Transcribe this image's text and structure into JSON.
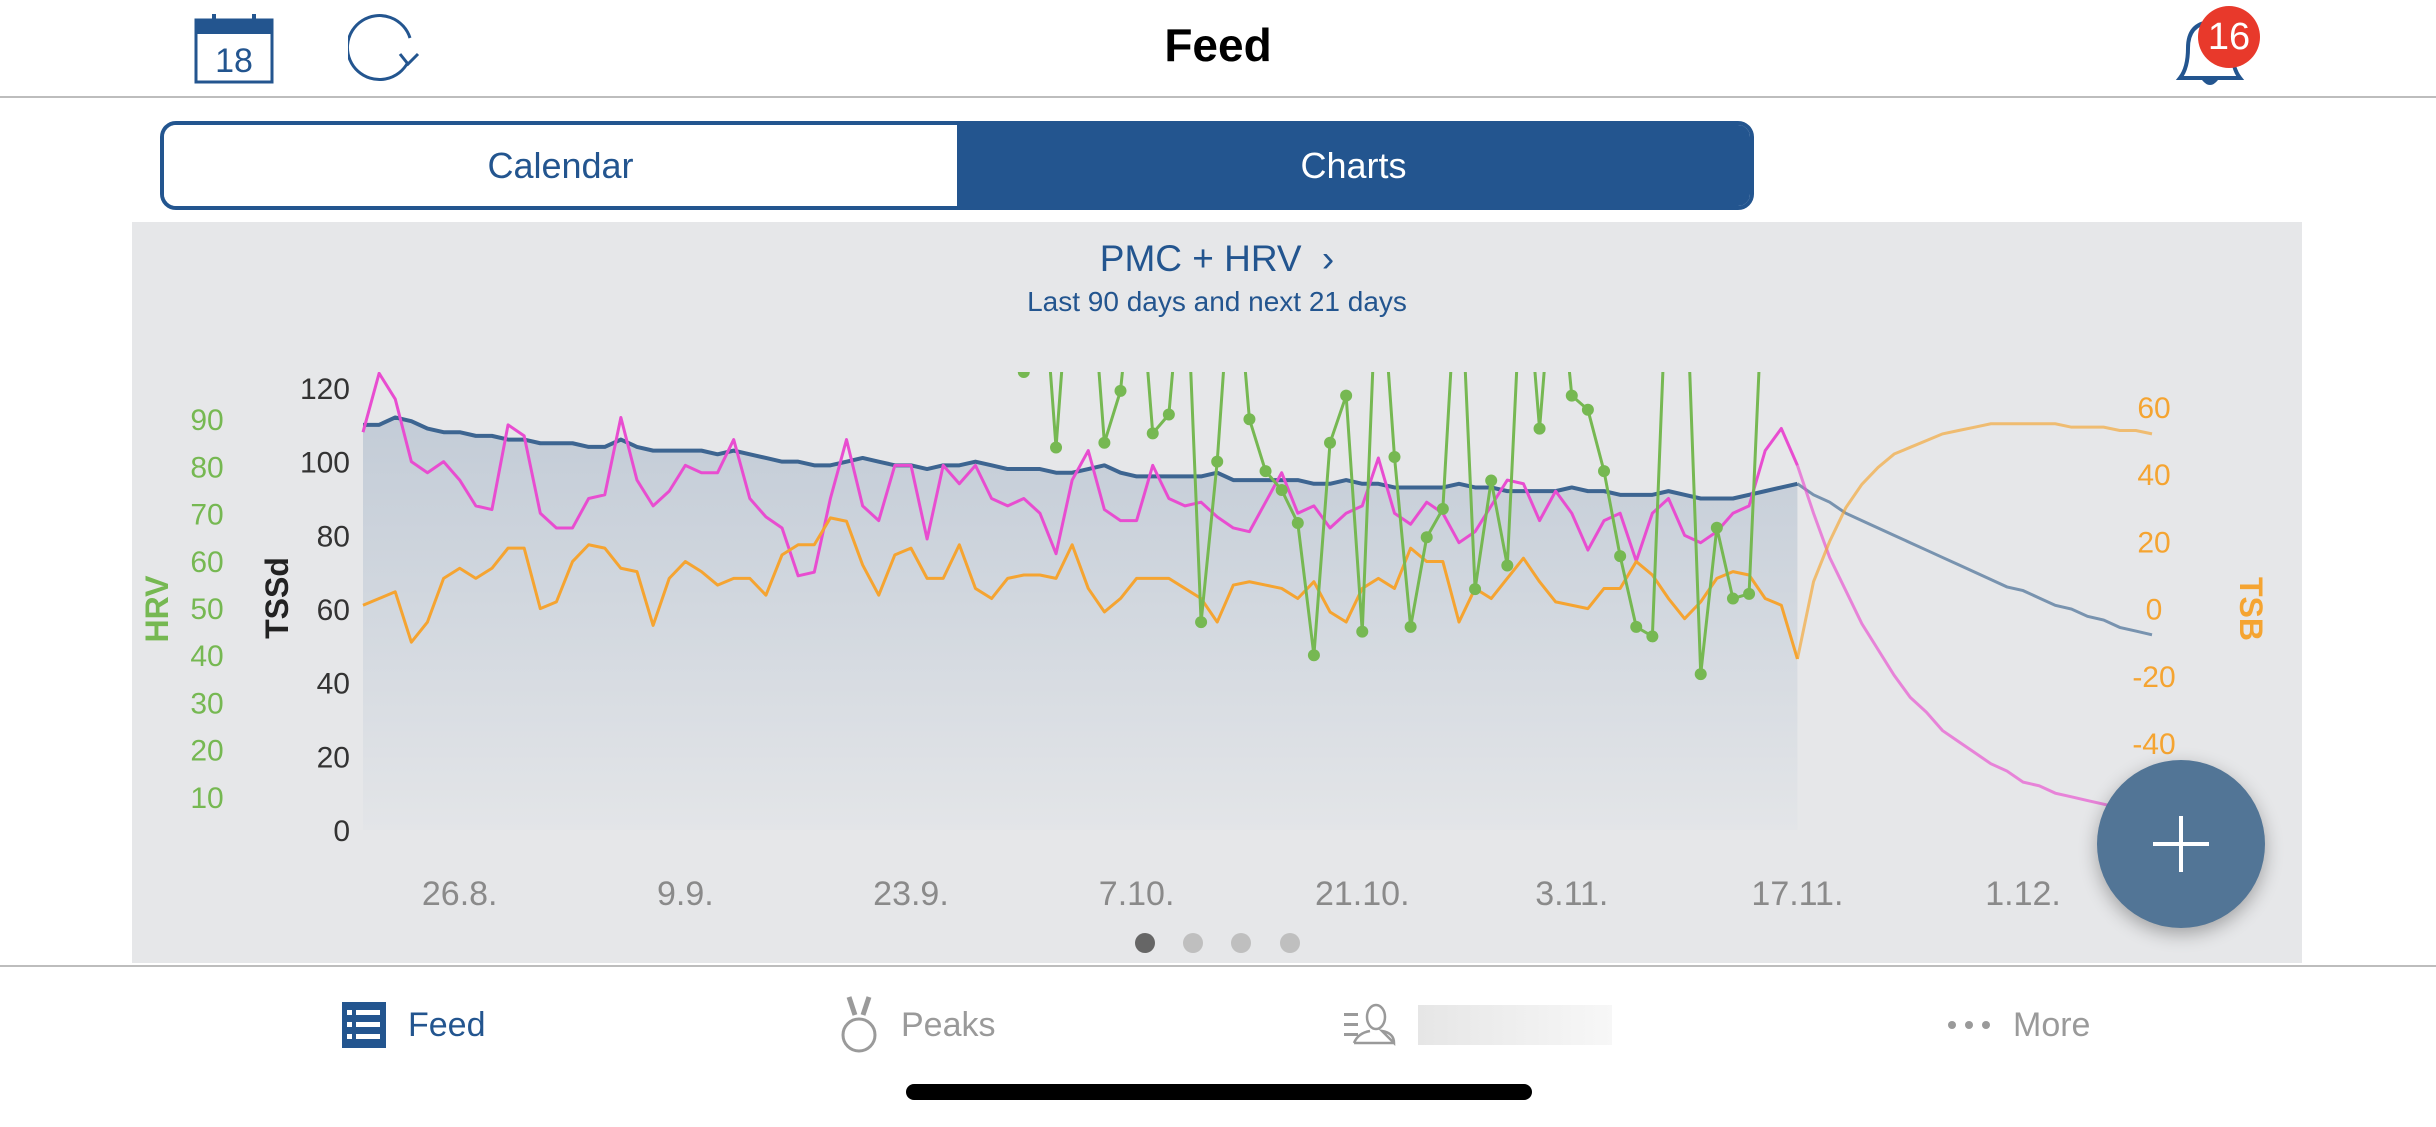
{
  "header": {
    "title": "Feed",
    "calendar_day": "18",
    "notification_count": "16"
  },
  "segments": [
    {
      "label": "Calendar",
      "selected": false
    },
    {
      "label": "Charts",
      "selected": true
    }
  ],
  "chart_card": {
    "title": "PMC + HRV",
    "subtitle": "Last 90 days and next 21 days",
    "page_count": 4,
    "current_page": 1
  },
  "tabs": [
    {
      "label": "Feed",
      "icon": "list-icon",
      "active": true
    },
    {
      "label": "Peaks",
      "icon": "medal-icon",
      "active": false
    },
    {
      "label": "",
      "icon": "athlete-list-icon",
      "active": false
    },
    {
      "label": "More",
      "icon": "more-dots-icon",
      "active": false
    }
  ],
  "fab": {
    "icon": "plus-icon"
  },
  "colors": {
    "accent": "#23558f",
    "ctl": "#3d6591",
    "atl": "#e84dd0",
    "tsb": "#f5a431",
    "hrv": "#76b852",
    "badge": "#e8392b",
    "fab": "#527596"
  },
  "chart_data": {
    "type": "line",
    "title": "PMC + HRV",
    "subtitle": "Last 90 days and next 21 days",
    "axes": {
      "hrv": {
        "label": "HRV",
        "side": "left-outer",
        "range": [
          0,
          100
        ],
        "ticks": [
          "10",
          "20",
          "30",
          "40",
          "50",
          "60",
          "70",
          "80",
          "90"
        ]
      },
      "tssd": {
        "label": "TSSd",
        "side": "left",
        "range": [
          0,
          124
        ],
        "ticks": [
          "0",
          "20",
          "40",
          "60",
          "80",
          "100",
          "120"
        ]
      },
      "tsb": {
        "label": "TSB",
        "side": "right",
        "range": [
          -66,
          70
        ],
        "ticks": [
          "-40",
          "-20",
          "0",
          "20",
          "40",
          "60"
        ]
      }
    },
    "x_ticks": [
      "26.8.",
      "9.9.",
      "23.9.",
      "7.10.",
      "21.10.",
      "3.11.",
      "17.11.",
      "1.12."
    ],
    "x": [
      "20.8.",
      "21.8.",
      "22.8.",
      "23.8.",
      "24.8.",
      "25.8.",
      "26.8.",
      "27.8.",
      "28.8.",
      "29.8.",
      "30.8.",
      "31.8.",
      "1.9.",
      "2.9.",
      "3.9.",
      "4.9.",
      "5.9.",
      "6.9.",
      "7.9.",
      "8.9.",
      "9.9.",
      "10.9.",
      "11.9.",
      "12.9.",
      "13.9.",
      "14.9.",
      "15.9.",
      "16.9.",
      "17.9.",
      "18.9.",
      "19.9.",
      "20.9.",
      "21.9.",
      "22.9.",
      "23.9.",
      "24.9.",
      "25.9.",
      "26.9.",
      "27.9.",
      "28.9.",
      "29.9.",
      "30.9.",
      "1.10.",
      "2.10.",
      "3.10.",
      "4.10.",
      "5.10.",
      "6.10.",
      "7.10.",
      "8.10.",
      "9.10.",
      "10.10.",
      "11.10.",
      "12.10.",
      "13.10.",
      "14.10.",
      "15.10.",
      "16.10.",
      "17.10.",
      "18.10.",
      "19.10.",
      "20.10.",
      "21.10.",
      "22.10.",
      "23.10.",
      "24.10.",
      "25.10.",
      "26.10.",
      "27.10.",
      "28.10.",
      "29.10.",
      "30.10.",
      "31.10.",
      "1.11.",
      "2.11.",
      "3.11.",
      "4.11.",
      "5.11.",
      "6.11.",
      "7.11.",
      "8.11.",
      "9.11.",
      "10.11.",
      "11.11.",
      "12.11.",
      "13.11.",
      "14.11.",
      "15.11.",
      "16.11.",
      "17.11.",
      "18.11.",
      "19.11.",
      "20.11.",
      "21.11.",
      "22.11.",
      "23.11.",
      "24.11.",
      "25.11.",
      "26.11.",
      "27.11.",
      "28.11.",
      "29.11.",
      "30.11.",
      "1.12.",
      "2.12.",
      "3.12.",
      "4.12.",
      "5.12.",
      "6.12.",
      "7.12.",
      "8.12.",
      "9.12."
    ],
    "today": "18.11.",
    "series": [
      {
        "key": "ctl",
        "axis": "tssd",
        "filled": true,
        "values": [
          110,
          110,
          112,
          111,
          109,
          108,
          108,
          107,
          107,
          106,
          106,
          105,
          105,
          105,
          104,
          104,
          106,
          104,
          103,
          103,
          103,
          103,
          102,
          103,
          102,
          101,
          100,
          100,
          99,
          99,
          100,
          101,
          100,
          99,
          99,
          98,
          99,
          99,
          100,
          99,
          98,
          98,
          98,
          97,
          97,
          98,
          99,
          97,
          96,
          96,
          96,
          96,
          96,
          97,
          95,
          95,
          95,
          95,
          95,
          94,
          94,
          95,
          94,
          94,
          93,
          93,
          93,
          93,
          94,
          93,
          93,
          92,
          92,
          92,
          92,
          93,
          92,
          92,
          91,
          91,
          91,
          92,
          91,
          90,
          90,
          90,
          91,
          92,
          93,
          94
        ],
        "forecast": [
          94,
          91,
          89,
          86,
          84,
          82,
          80,
          78,
          76,
          74,
          72,
          70,
          68,
          66,
          65,
          63,
          61,
          60,
          58,
          57,
          55,
          54,
          53
        ]
      },
      {
        "key": "atl",
        "axis": "tssd",
        "values": [
          108,
          124,
          117,
          100,
          97,
          100,
          95,
          88,
          87,
          110,
          107,
          86,
          82,
          82,
          90,
          91,
          112,
          95,
          88,
          92,
          99,
          97,
          97,
          106,
          90,
          85,
          82,
          69,
          70,
          90,
          106,
          88,
          84,
          99,
          99,
          79,
          99,
          94,
          99,
          90,
          88,
          90,
          86,
          75,
          95,
          103,
          87,
          84,
          84,
          99,
          90,
          88,
          89,
          85,
          82,
          81,
          89,
          97,
          86,
          88,
          82,
          86,
          88,
          101,
          86,
          83,
          89,
          86,
          78,
          81,
          88,
          95,
          94,
          84,
          92,
          86,
          76,
          84,
          86,
          73,
          86,
          90,
          80,
          78,
          81,
          86,
          88,
          103,
          109,
          99
        ],
        "forecast": [
          99,
          86,
          74,
          65,
          56,
          49,
          42,
          36,
          32,
          27,
          24,
          21,
          18,
          16,
          13,
          12,
          10,
          9,
          8,
          7,
          6,
          5,
          4
        ]
      },
      {
        "key": "tsb",
        "axis": "tsb",
        "values": [
          1,
          3,
          5,
          -10,
          -4,
          9,
          12,
          9,
          12,
          18,
          18,
          0,
          2,
          14,
          19,
          18,
          12,
          11,
          -5,
          9,
          14,
          11,
          7,
          9,
          9,
          4,
          16,
          19,
          19,
          27,
          26,
          13,
          4,
          16,
          18,
          9,
          9,
          19,
          6,
          3,
          9,
          10,
          10,
          9,
          19,
          6,
          -1,
          3,
          9,
          9,
          9,
          6,
          3,
          -4,
          7,
          8,
          7,
          6,
          3,
          8,
          -1,
          -4,
          6,
          9,
          6,
          18,
          14,
          14,
          -4,
          6,
          3,
          9,
          15,
          8,
          2,
          1,
          0,
          6,
          6,
          14,
          10,
          3,
          -3,
          2,
          9,
          11,
          10,
          3,
          1,
          -15
        ],
        "forecast": [
          -15,
          8,
          20,
          30,
          37,
          42,
          46,
          48,
          50,
          52,
          53,
          54,
          55,
          55,
          55,
          55,
          55,
          54,
          54,
          54,
          53,
          53,
          52
        ]
      },
      {
        "key": "hrv",
        "axis": "hrv",
        "markers": true,
        "values": [
          null,
          null,
          null,
          null,
          null,
          null,
          null,
          null,
          null,
          null,
          null,
          null,
          null,
          null,
          null,
          null,
          null,
          null,
          null,
          null,
          null,
          null,
          null,
          null,
          null,
          null,
          null,
          null,
          null,
          null,
          null,
          null,
          null,
          null,
          null,
          null,
          null,
          null,
          null,
          null,
          null,
          100,
          130,
          84,
          130,
          130,
          85,
          96,
          130,
          87,
          91,
          130,
          47,
          81,
          130,
          90,
          79,
          75,
          68,
          40,
          85,
          95,
          45,
          130,
          82,
          46,
          65,
          71,
          130,
          54,
          77,
          59,
          130,
          88,
          130,
          95,
          92,
          79,
          61,
          46,
          44,
          130,
          130,
          36,
          67,
          52,
          53,
          130,
          null,
          null
        ]
      }
    ]
  }
}
